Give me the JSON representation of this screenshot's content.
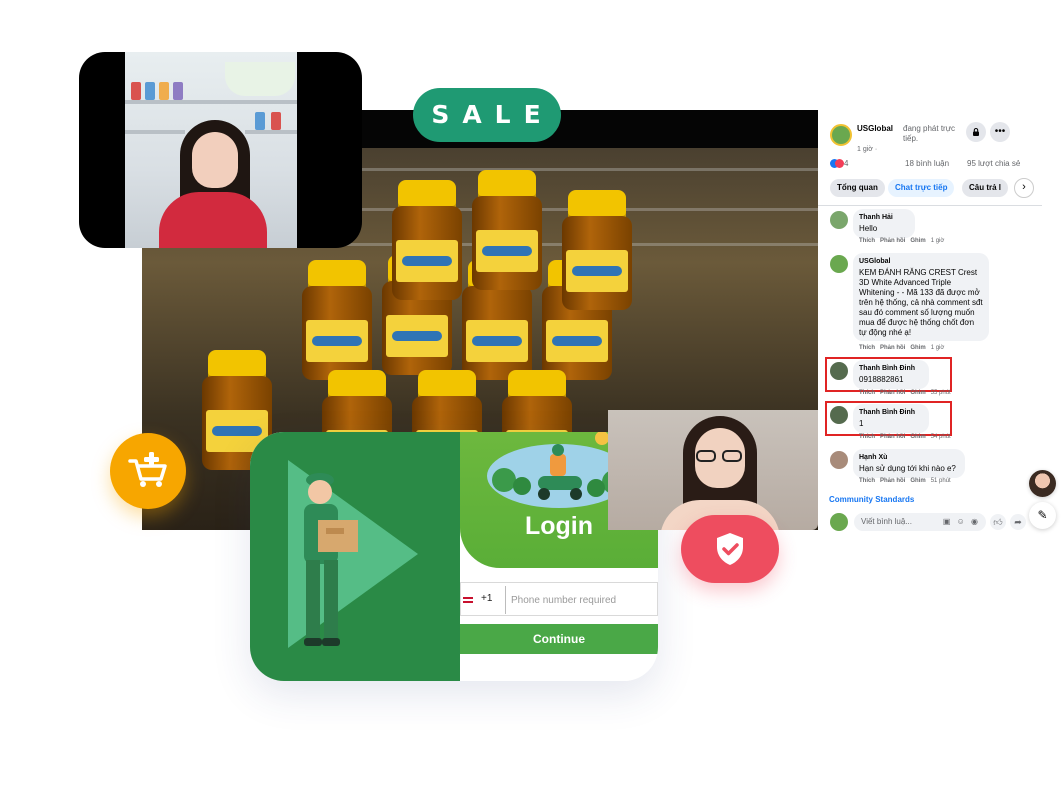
{
  "promo": {
    "sale_label": "SALE"
  },
  "live_post": {
    "page_name": "USGlobal",
    "status_text": "đang phát trực tiếp.",
    "time": "1 giờ ·",
    "reaction_count": "4",
    "comment_count": "18 bình luận",
    "share_count": "95 lượt chia sẻ",
    "tabs": [
      {
        "label": "Tổng quan"
      },
      {
        "label": "Chat trực tiếp"
      },
      {
        "label": "Câu trả l"
      }
    ],
    "actions": {
      "like": "Thích",
      "reply": "Phản hồi",
      "pin": "Ghim"
    },
    "comments": [
      {
        "author": "Thanh Hải",
        "text": "Hello",
        "time": "1 giờ"
      },
      {
        "author": "USGlobal",
        "text": "KEM ĐÁNH RĂNG CREST Crest 3D White Advanced Triple Whitening - - Mã 133 đã được mở trên hệ thống, cả nhà comment sđt sau đó comment số lượng muốn mua để được hệ thống chốt đơn tự động nhé ạ!",
        "time": "1 giờ"
      },
      {
        "author": "Thanh Bình Đinh",
        "text": "0918882861",
        "time": "55 phút"
      },
      {
        "author": "Thanh Bình Đinh",
        "text": "1",
        "time": "54 phút"
      },
      {
        "author": "Hạnh Xù",
        "text": "Hạn sử dụng tới khi nào e?",
        "time": "51 phút"
      }
    ],
    "community_standards": "Community Standards",
    "compose_placeholder": "Viết bình luậ..."
  },
  "login": {
    "title": "Login",
    "country_code": "+1",
    "phone_placeholder": "Phone number required",
    "continue_label": "Continue"
  },
  "colors": {
    "sale_green": "#1f9a73",
    "cart_orange": "#f7a600",
    "shield_red": "#ee4d5f",
    "login_green": "#4aa847",
    "fb_blue": "#1877f2",
    "highlight_red": "#e02424"
  },
  "icons": [
    "cart-plus-icon",
    "shield-check-icon",
    "lock-icon",
    "more-icon",
    "chevron-right-icon",
    "edit-icon",
    "like-icon",
    "share-icon"
  ]
}
